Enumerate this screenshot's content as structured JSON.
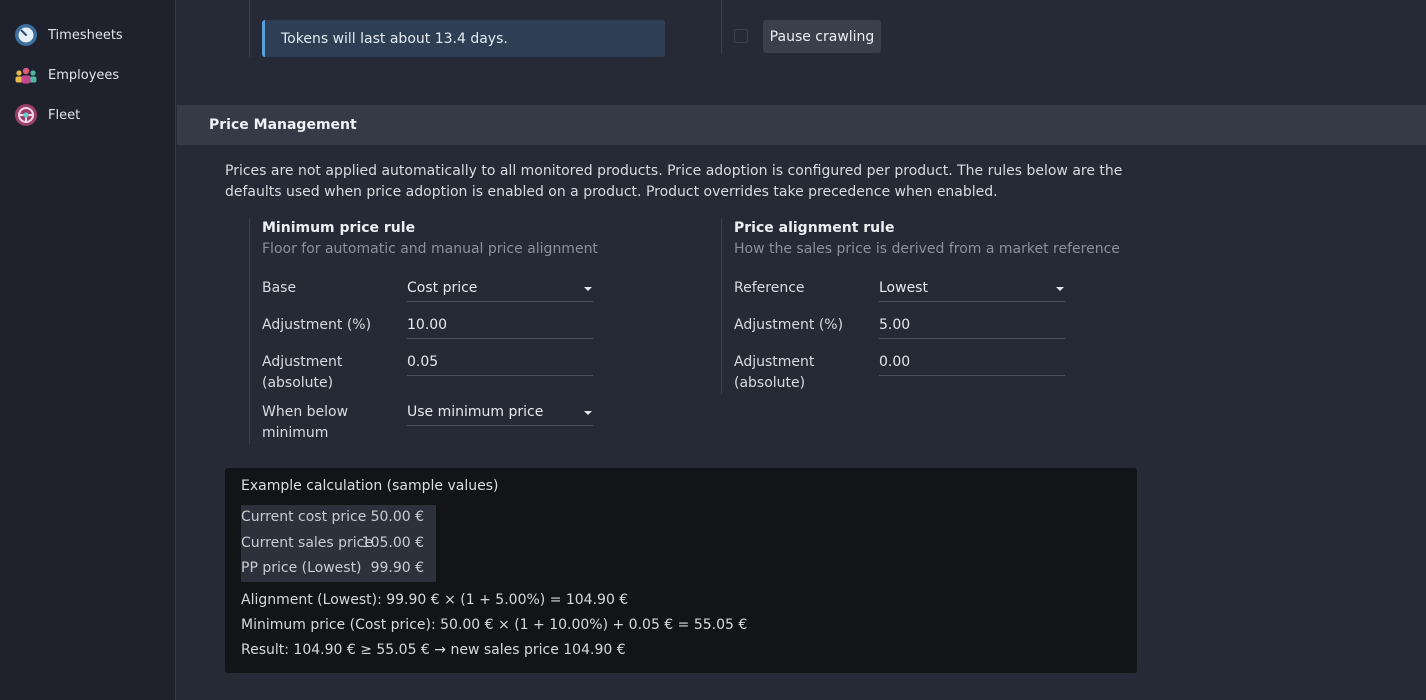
{
  "sidebar": {
    "items": [
      {
        "label": "Timesheets",
        "icon": "timesheets-icon"
      },
      {
        "label": "Employees",
        "icon": "employees-icon"
      },
      {
        "label": "Fleet",
        "icon": "fleet-icon"
      }
    ]
  },
  "crawling": {
    "info_text": "Tokens will last about 13.4 days.",
    "pause_button": "Pause crawling",
    "pause_checked": false
  },
  "price_management": {
    "title": "Price Management",
    "description": "Prices are not applied automatically to all monitored products. Price adoption is configured per product. The rules below are the defaults used when price adoption is enabled on a product. Product overrides take precedence when enabled.",
    "min_rule": {
      "title": "Minimum price rule",
      "subtitle": "Floor for automatic and manual price alignment",
      "base_label": "Base",
      "base_value": "Cost price",
      "adj_pct_label": "Adjustment (%)",
      "adj_pct_value": "10.00",
      "adj_abs_label": "Adjustment (absolute)",
      "adj_abs_value": "0.05",
      "below_label": "When below minimum",
      "below_value": "Use minimum price"
    },
    "align_rule": {
      "title": "Price alignment rule",
      "subtitle": "How the sales price is derived from a market reference",
      "ref_label": "Reference",
      "ref_value": "Lowest",
      "adj_pct_label": "Adjustment (%)",
      "adj_pct_value": "5.00",
      "adj_abs_label": "Adjustment (absolute)",
      "adj_abs_value": "0.00"
    },
    "example": {
      "title": "Example calculation (sample values)",
      "rows": [
        {
          "label": "Current cost price",
          "value": "50.00 €"
        },
        {
          "label": "Current sales price",
          "value": "105.00 €"
        },
        {
          "label": "PP price (Lowest)",
          "value": "99.90 €"
        }
      ],
      "alignment_line": "Alignment (Lowest): 99.90 € × (1 + 5.00%) = 104.90 €",
      "minimum_line": "Minimum price (Cost price): 50.00 € × (1 + 10.00%) + 0.05 € = 55.05 €",
      "result_line": "Result: 104.90 € ≥ 55.05 € → new sales price 104.90 €"
    }
  },
  "colors": {
    "accent": "#5aa0dc",
    "background": "#262a36",
    "sidebar": "#1f222c"
  }
}
